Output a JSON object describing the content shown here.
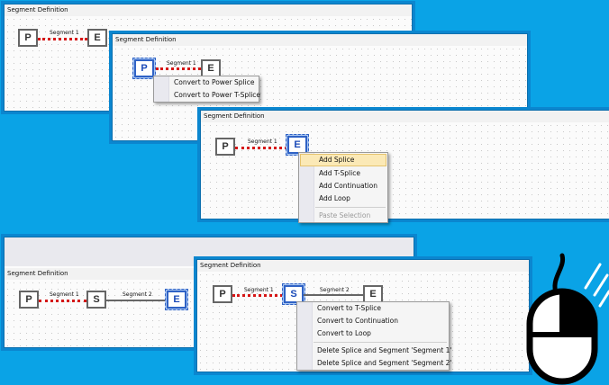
{
  "panel_title": "Segment Definition",
  "nodes": {
    "p": "P",
    "e": "E",
    "s": "S"
  },
  "segments": {
    "seg1": "Segment 1",
    "seg2": "Segment 2"
  },
  "menu_power": [
    "Convert to Power Splice",
    "Convert to Power T-Splice"
  ],
  "menu_add": {
    "items": [
      "Add Splice",
      "Add T-Splice",
      "Add Continuation",
      "Add Loop"
    ],
    "disabled": "Paste Selection",
    "highlighted_index": 0
  },
  "menu_splice": {
    "group1": [
      "Convert to T-Splice",
      "Convert to Continuation",
      "Convert to Loop"
    ],
    "group2": [
      "Delete Splice and Segment 'Segment 1'",
      "Delete Splice and Segment 'Segment 2'"
    ]
  },
  "colors": {
    "background": "#0aa3e6",
    "segment_red": "#d51616",
    "selection_blue": "#2f62c5"
  },
  "icons": [
    "mouse-right-click-icon"
  ]
}
